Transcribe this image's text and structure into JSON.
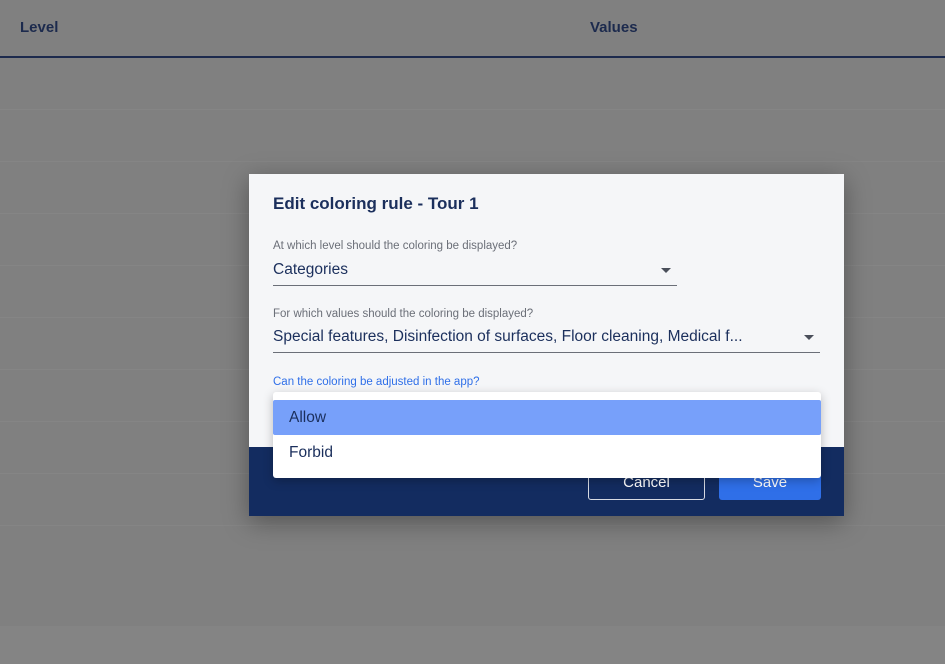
{
  "table": {
    "headers": {
      "level": "Level",
      "values": "Values"
    }
  },
  "dialog": {
    "title": "Edit coloring rule - Tour 1",
    "level_field": {
      "label": "At which level should the coloring be displayed?",
      "value": "Categories"
    },
    "values_field": {
      "label": "For which values should the coloring be displayed?",
      "value": "Special features, Disinfection of surfaces, Floor cleaning, Medical f..."
    },
    "adjust_field": {
      "label": "Can the coloring be adjusted in the app?"
    },
    "buttons": {
      "cancel": "Cancel",
      "save": "Save"
    }
  },
  "dropdown": {
    "options": [
      {
        "label": "Allow",
        "highlighted": true
      },
      {
        "label": "Forbid",
        "highlighted": false
      }
    ]
  },
  "colors": {
    "overlay": "#808080",
    "dialog_bg": "#f5f6f8",
    "footer_bg": "#132c60",
    "accent": "#2f6fe8",
    "highlight": "#77a0fa",
    "text_primary": "#1b2f5c"
  }
}
